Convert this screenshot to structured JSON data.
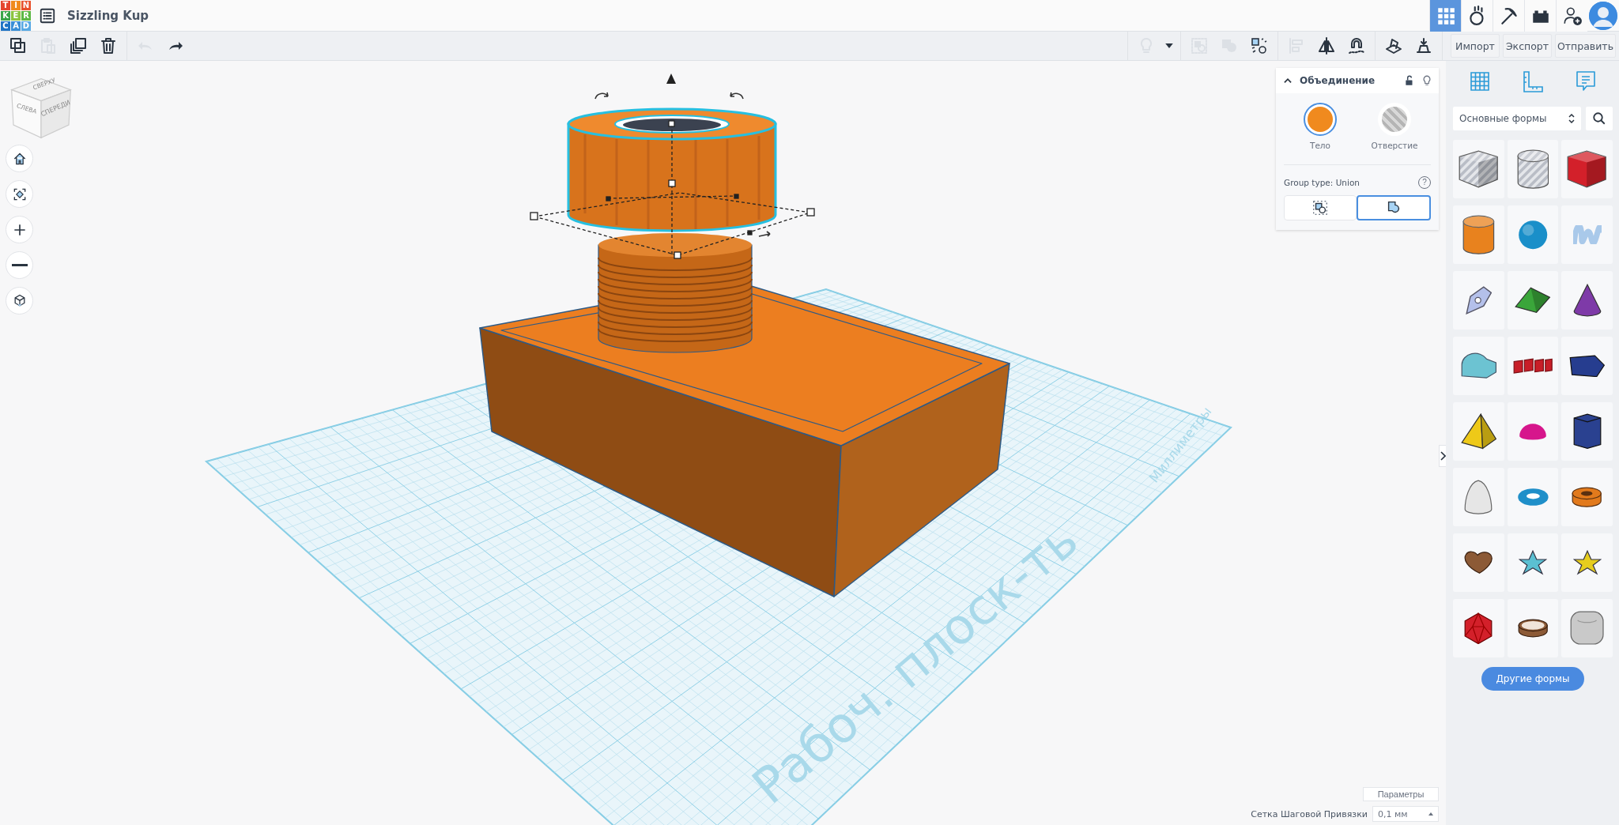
{
  "header": {
    "logo": [
      {
        "letter": "T",
        "color": "#e5452f"
      },
      {
        "letter": "I",
        "color": "#f08a1c"
      },
      {
        "letter": "N",
        "color": "#e8512b"
      },
      {
        "letter": "K",
        "color": "#3aa54a"
      },
      {
        "letter": "E",
        "color": "#8cc43f"
      },
      {
        "letter": "R",
        "color": "#5cb845"
      },
      {
        "letter": "C",
        "color": "#1f74c4"
      },
      {
        "letter": "A",
        "color": "#3a8fd6"
      },
      {
        "letter": "D",
        "color": "#58a9e3"
      }
    ],
    "title": "Sizzling Kup",
    "views": [
      {
        "kind": "design",
        "selected": true
      },
      {
        "kind": "sim",
        "selected": false
      },
      {
        "kind": "pickaxe",
        "selected": false
      },
      {
        "kind": "bricks",
        "selected": false
      }
    ]
  },
  "toolbar": {
    "tools": [
      {
        "kind": "copy",
        "disabled": false
      },
      {
        "kind": "paste",
        "disabled": true
      },
      {
        "kind": "duplicate",
        "disabled": false
      },
      {
        "kind": "delete",
        "disabled": false
      },
      {
        "kind": "undo",
        "disabled": true
      },
      {
        "kind": "redo",
        "disabled": false
      }
    ],
    "view_tools": [
      {
        "kind": "bulb",
        "disabled": true
      },
      {
        "kind": "caret",
        "disabled": false
      },
      {
        "kind": "group",
        "disabled": true
      },
      {
        "kind": "ungroup",
        "disabled": true
      },
      {
        "kind": "cruise",
        "disabled": false
      },
      {
        "kind": "align",
        "disabled": true
      },
      {
        "kind": "mirror",
        "disabled": false
      },
      {
        "kind": "magnet",
        "disabled": false
      },
      {
        "kind": "workplane",
        "disabled": false
      },
      {
        "kind": "drop",
        "disabled": false
      }
    ],
    "actions": [
      "Импорт",
      "Экспорт",
      "Отправить"
    ]
  },
  "viewcube": {
    "faces": [
      "СВЕРХУ",
      "СЛЕВА",
      "СПЕРЕДИ"
    ]
  },
  "workplane": {
    "label": "Рабоч. плоск-ть",
    "units": "Миллиметры"
  },
  "inspector": {
    "title": "Объединение",
    "expanded": true,
    "modes": [
      {
        "label": "Тело",
        "selected": true
      },
      {
        "label": "Отверстие",
        "selected": false
      }
    ],
    "group_type": "Group type: Union",
    "help": "?",
    "group_buttons": [
      {
        "kind": "combine",
        "selected": false
      },
      {
        "kind": "union",
        "selected": true
      }
    ]
  },
  "shapes": {
    "category": "Основные формы",
    "items": [
      {
        "kind": "box",
        "hole": true
      },
      {
        "kind": "cylinder",
        "hole": true
      },
      {
        "kind": "box",
        "hole": false,
        "color": "#d3202a"
      },
      {
        "kind": "cylinder",
        "hole": false,
        "color": "#e8821e"
      },
      {
        "kind": "sphere",
        "hole": false,
        "color": "#1a8fc9"
      },
      {
        "kind": "scribble",
        "hole": false,
        "color": "#a9c9ea"
      },
      {
        "kind": "pen",
        "hole": false,
        "color": "#b4c0ea"
      },
      {
        "kind": "roof",
        "hole": false,
        "color": "#3aa63a"
      },
      {
        "kind": "cone",
        "hole": false,
        "color": "#7e3aa8"
      },
      {
        "kind": "round-roof",
        "hole": false,
        "color": "#6cc3d2"
      },
      {
        "kind": "text",
        "hole": false,
        "color": "#c81e28"
      },
      {
        "kind": "prism",
        "hole": false,
        "color": "#263d8f"
      },
      {
        "kind": "pyramid",
        "hole": false,
        "color": "#eec918"
      },
      {
        "kind": "half-sphere",
        "hole": false,
        "color": "#d6168c"
      },
      {
        "kind": "polygon",
        "hole": false,
        "color": "#2a4190"
      },
      {
        "kind": "paraboloid",
        "hole": false,
        "color": "#e6e6e6"
      },
      {
        "kind": "torus",
        "hole": false,
        "color": "#1f8fc9"
      },
      {
        "kind": "tube",
        "hole": false,
        "color": "#e27a1c"
      },
      {
        "kind": "heart",
        "hole": false,
        "color": "#8c5a36"
      },
      {
        "kind": "star",
        "hole": false,
        "color": "#5bc0d2"
      },
      {
        "kind": "star",
        "hole": false,
        "color": "#e6cd1e"
      },
      {
        "kind": "icosahedron",
        "hole": false,
        "color": "#d3202a"
      },
      {
        "kind": "ring",
        "hole": false,
        "color": "#8c5a36"
      },
      {
        "kind": "rounded-box",
        "hole": false,
        "color": "#c9c9c9"
      }
    ],
    "more_button": "Другие формы"
  },
  "footer": {
    "settings": "Параметры",
    "snap_label": "Сетка Шаговой Привязки",
    "snap_value": "0,1 мм"
  }
}
